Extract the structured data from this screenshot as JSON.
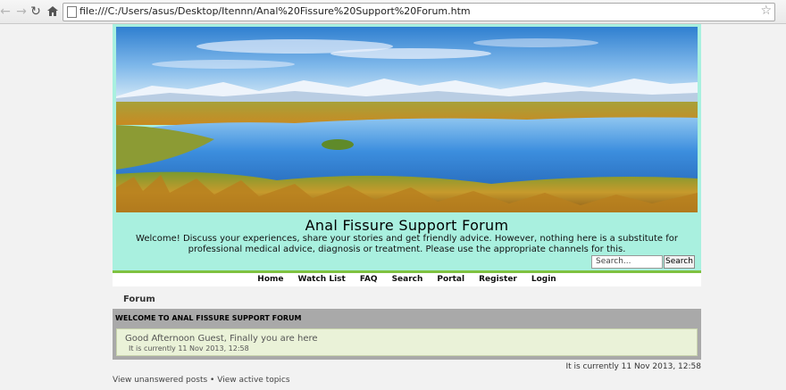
{
  "browser": {
    "url": "file:///C:/Users/asus/Desktop/Itennn/Anal%20Fissure%20Support%20Forum.htm",
    "icons": [
      "back-arrow-icon",
      "forward-arrow-icon",
      "reload-icon",
      "home-icon",
      "page-icon",
      "star-icon"
    ]
  },
  "header": {
    "title": "Anal Fissure Support Forum",
    "description": "Welcome! Discuss your experiences, share your stories and get friendly advice. However, nothing here is a substitute for professional medical advice, diagnosis or treatment. Please use the appropriate channels for this.",
    "search_placeholder": "Search...",
    "search_button": "Search"
  },
  "nav": {
    "items": [
      {
        "label": "Home"
      },
      {
        "label": "Watch List"
      },
      {
        "label": "FAQ"
      },
      {
        "label": "Search"
      },
      {
        "label": "Portal"
      },
      {
        "label": "Register"
      },
      {
        "label": "Login"
      }
    ]
  },
  "breadcrumb": {
    "label": "Forum"
  },
  "welcome": {
    "heading": "WELCOME TO ANAL FISSURE SUPPORT FORUM",
    "greeting": "Good Afternoon Guest, Finally you are here",
    "time": "It is currently 11 Nov 2013, 12:58"
  },
  "footer": {
    "current_time": "It is currently 11 Nov 2013, 12:58",
    "unanswered": "View unanswered posts",
    "separator": "•",
    "active": "View active topics"
  },
  "colors": {
    "header_bg": "#a9f0df",
    "header_border": "#7fc241",
    "welcome_box": "#a9a9a9",
    "welcome_inner": "#eaf2d8"
  }
}
